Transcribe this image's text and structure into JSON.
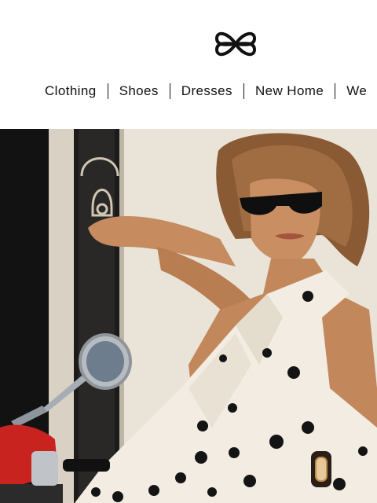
{
  "brand": {
    "logo_icon": "pretzel-knot-logo-icon"
  },
  "nav": {
    "items": [
      {
        "label": "Clothing"
      },
      {
        "label": "Shoes"
      },
      {
        "label": "Dresses"
      },
      {
        "label": "New Home"
      },
      {
        "label": "We"
      }
    ]
  },
  "hero": {
    "image_icon": "hero-photo-icon",
    "colors": {
      "wall": "#e4ded2",
      "door_dark": "#1a1a1a",
      "skin": "#c98e63",
      "dress": "#f2ece2",
      "dots": "#141414",
      "scooter_red": "#c8231e"
    }
  }
}
